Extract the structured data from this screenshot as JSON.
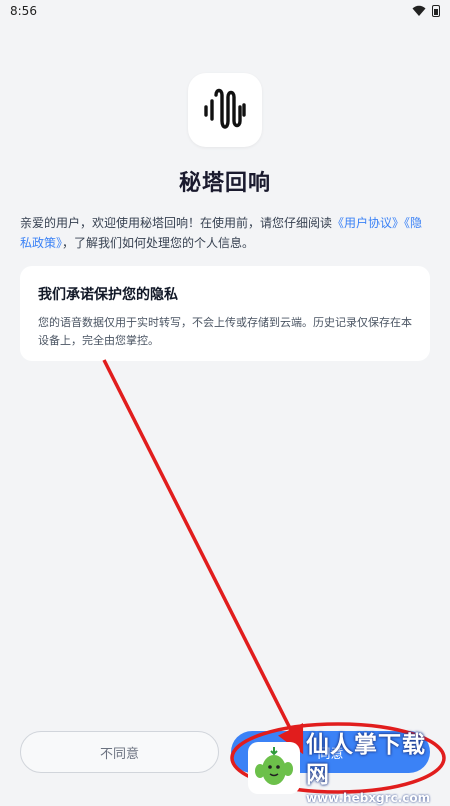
{
  "status_bar": {
    "time": "8:56"
  },
  "app": {
    "title": "秘塔回响"
  },
  "intro": {
    "text_before": "亲爱的用户，欢迎使用秘塔回响！在使用前，请您仔细阅读",
    "user_agreement": "《用户协议》",
    "privacy_policy": "《隐私政策》",
    "text_after": "，了解我们如何处理您的个人信息。"
  },
  "privacy_card": {
    "title": "我们承诺保护您的隐私",
    "body": "您的语音数据仅用于实时转写，不会上传或存储到云端。历史记录仅保存在本设备上，完全由您掌控。"
  },
  "buttons": {
    "decline_label": "不同意",
    "agree_label": "同意"
  },
  "watermark": {
    "main": "仙人掌下载网",
    "url": "www.hebxgrc.com"
  },
  "colors": {
    "accent": "#3b82f6",
    "background": "#f3f4f6",
    "annotation": "#e11d1d"
  }
}
